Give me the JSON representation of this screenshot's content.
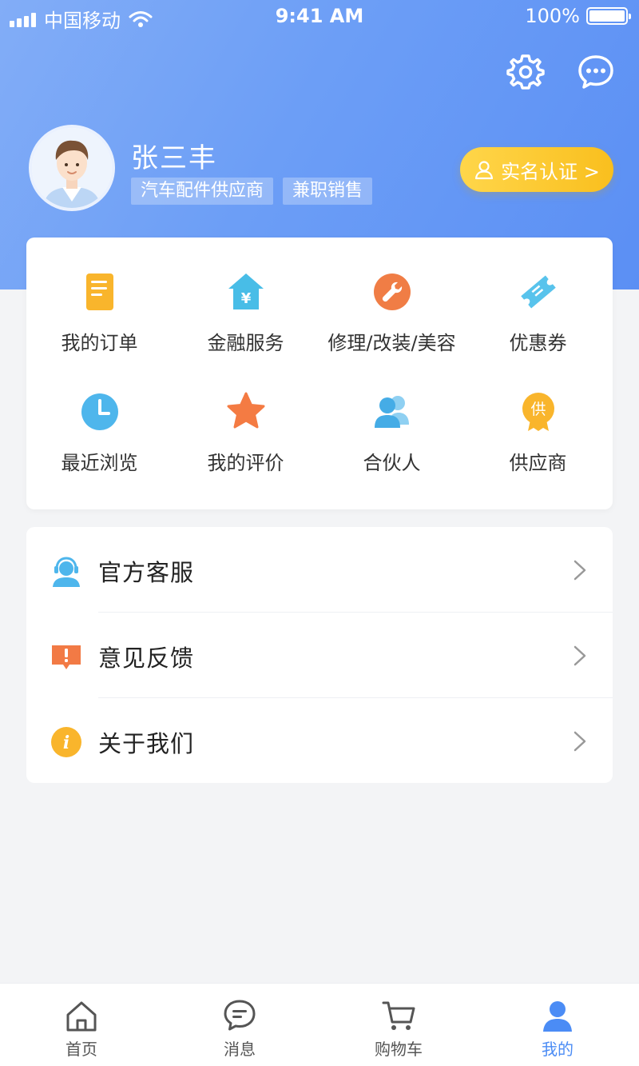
{
  "status_bar": {
    "carrier": "中国移动",
    "time": "9:41 AM",
    "battery": "100%"
  },
  "header": {
    "settings_icon": "gear-icon",
    "message_icon": "chat-bubble-icon"
  },
  "profile": {
    "name": "张三丰",
    "tags": [
      "汽车配件供应商",
      "兼职销售"
    ],
    "verify_label": "实名认证 >"
  },
  "grid": [
    {
      "label": "我的订单",
      "icon": "order-icon"
    },
    {
      "label": "金融服务",
      "icon": "finance-icon"
    },
    {
      "label": "修理/改装/美容",
      "icon": "wrench-icon"
    },
    {
      "label": "优惠券",
      "icon": "coupon-icon"
    },
    {
      "label": "最近浏览",
      "icon": "clock-icon"
    },
    {
      "label": "我的评价",
      "icon": "star-icon"
    },
    {
      "label": "合伙人",
      "icon": "partners-icon"
    },
    {
      "label": "供应商",
      "icon": "supplier-icon",
      "badge": "供"
    }
  ],
  "menu": [
    {
      "label": "官方客服",
      "icon": "customer-service-icon"
    },
    {
      "label": "意见反馈",
      "icon": "feedback-icon"
    },
    {
      "label": "关于我们",
      "icon": "info-icon",
      "glyph": "i"
    }
  ],
  "tabbar": [
    {
      "label": "首页",
      "icon": "home-icon"
    },
    {
      "label": "消息",
      "icon": "message-icon"
    },
    {
      "label": "购物车",
      "icon": "cart-icon"
    },
    {
      "label": "我的",
      "icon": "profile-icon",
      "active": true
    }
  ],
  "colors": {
    "primary": "#5b8ff4",
    "accent_yellow": "#f9bf1e",
    "active_tab": "#4b8cf5"
  }
}
